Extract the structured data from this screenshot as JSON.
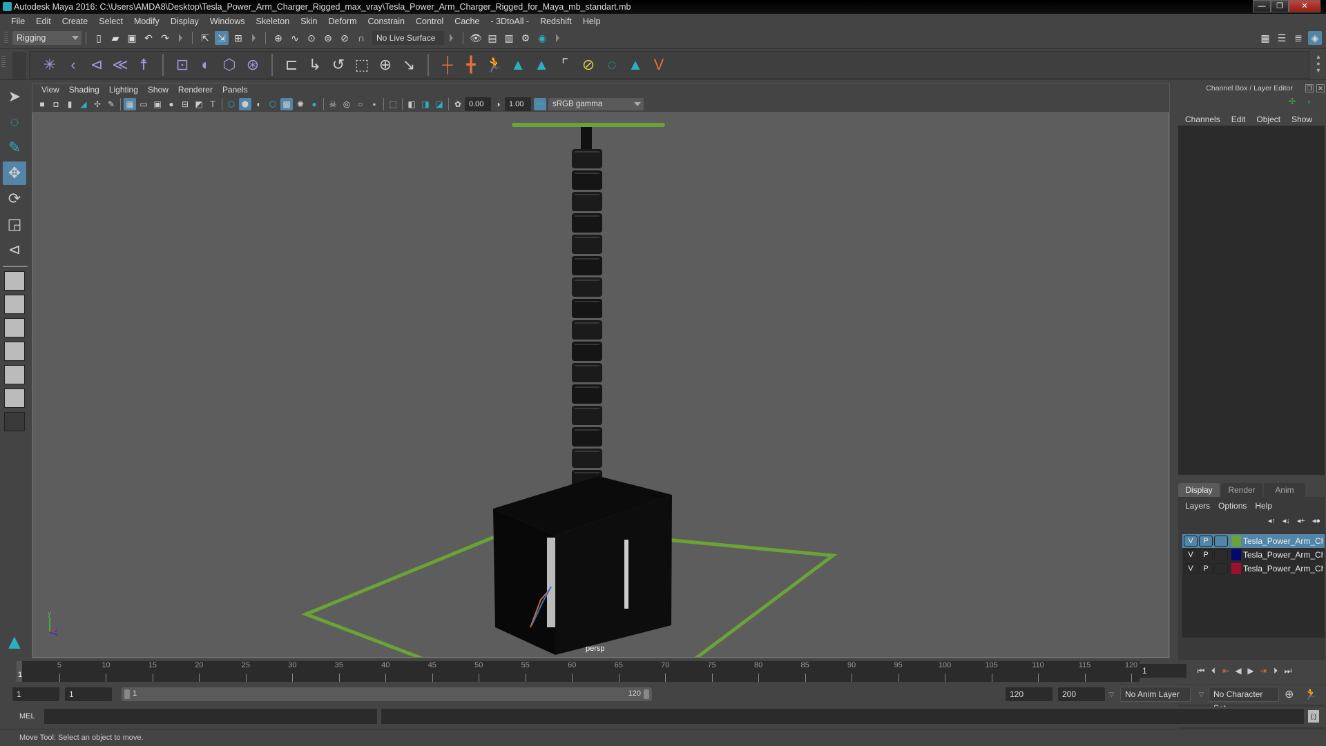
{
  "window": {
    "title": "Autodesk Maya 2016: C:\\Users\\AMDA8\\Desktop\\Tesla_Power_Arm_Charger_Rigged_max_vray\\Tesla_Power_Arm_Charger_Rigged_for_Maya_mb_standart.mb",
    "minimize": "—",
    "restore": "❐",
    "close": "✕"
  },
  "menubar": [
    "File",
    "Edit",
    "Create",
    "Select",
    "Modify",
    "Display",
    "Windows",
    "Skeleton",
    "Skin",
    "Deform",
    "Constrain",
    "Control",
    "Cache",
    "- 3DtoAll -",
    "Redshift",
    "Help"
  ],
  "statusline": {
    "menuset": "Rigging",
    "live_surface": "No Live Surface"
  },
  "viewport": {
    "menus": [
      "View",
      "Shading",
      "Lighting",
      "Show",
      "Renderer",
      "Panels"
    ],
    "exposure": "0.00",
    "gamma": "1.00",
    "color_management": "ON",
    "color_space": "sRGB gamma",
    "camera": "persp",
    "axis": {
      "y": "y",
      "z": "z",
      "x": "x"
    }
  },
  "channel_box": {
    "title": "Channel Box / Layer Editor",
    "menus": [
      "Channels",
      "Edit",
      "Object",
      "Show"
    ]
  },
  "layer_editor": {
    "tabs": [
      "Display",
      "Render",
      "Anim"
    ],
    "active_tab": "Display",
    "menus": [
      "Layers",
      "Options",
      "Help"
    ],
    "layers": [
      {
        "v": "V",
        "p": "P",
        "color": "#6aa336",
        "name": "Tesla_Power_Arm_Charger",
        "selected": true
      },
      {
        "v": "V",
        "p": "P",
        "color": "#000a6e",
        "name": "Tesla_Power_Arm_Charger",
        "selected": false
      },
      {
        "v": "V",
        "p": "P",
        "color": "#a0102e",
        "name": "Tesla_Power_Arm_Charger",
        "selected": false
      }
    ]
  },
  "timeline": {
    "ticks": [
      5,
      10,
      15,
      20,
      25,
      30,
      35,
      40,
      45,
      50,
      55,
      60,
      65,
      70,
      75,
      80,
      85,
      90,
      95,
      100,
      105,
      110,
      115,
      120
    ],
    "range": [
      1,
      120
    ],
    "current_frame_marker": "1",
    "current_frame": "1"
  },
  "range_slider": {
    "start_time": "1",
    "playback_start": "1",
    "range_start_label": "1",
    "range_end_label": "120",
    "playback_end": "120",
    "end_time": "200",
    "anim_layer": "No Anim Layer",
    "character_set": "No Character Set"
  },
  "command_line": {
    "language": "MEL"
  },
  "help_line": "Move Tool: Select an object to move."
}
